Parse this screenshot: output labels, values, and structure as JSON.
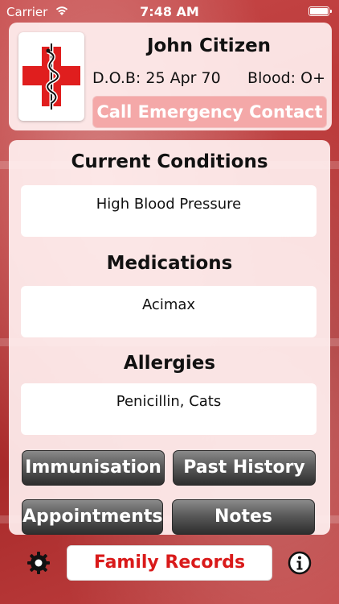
{
  "status_bar": {
    "carrier": "Carrier",
    "time": "7:48 AM"
  },
  "profile": {
    "name": "John Citizen",
    "dob_label": "D.O.B:",
    "dob_value": "25 Apr 70",
    "blood_label": "Blood:",
    "blood_value": "O+",
    "emergency_button": "Call Emergency Contact"
  },
  "sections": {
    "conditions": {
      "title": "Current Conditions",
      "value": "High Blood Pressure"
    },
    "medications": {
      "title": "Medications",
      "value": "Acimax"
    },
    "allergies": {
      "title": "Allergies",
      "value": "Penicillin, Cats"
    }
  },
  "buttons": {
    "immunisation": "Immunisation",
    "past_history": "Past History",
    "appointments": "Appointments",
    "notes": "Notes"
  },
  "footer": {
    "family_records": "Family Records"
  },
  "icons": {
    "settings": "gear-icon",
    "info": "info-icon",
    "logo": "medical-cross-logo"
  },
  "colors": {
    "accent_red": "#d91a1a",
    "emergency_button": "#f4a8a8"
  }
}
